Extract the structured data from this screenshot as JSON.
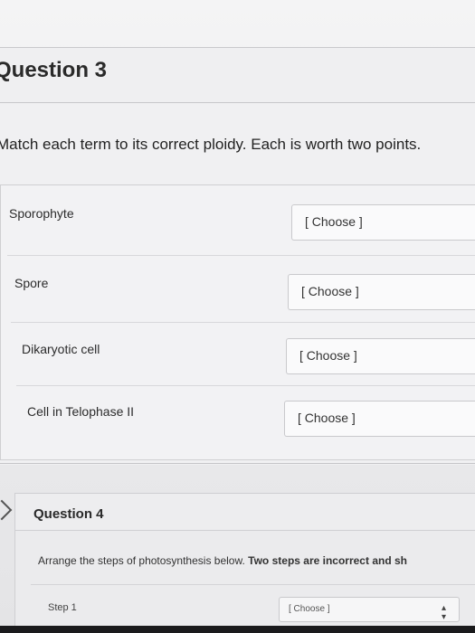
{
  "question3": {
    "title": "Question 3",
    "prompt": "Match each term to its correct ploidy. Each is worth two points.",
    "rows": [
      {
        "term": "Sporophyte",
        "select_value": "[ Choose ]"
      },
      {
        "term": "Spore",
        "select_value": "[ Choose ]"
      },
      {
        "term": "Dikaryotic cell",
        "select_value": "[ Choose ]"
      },
      {
        "term": "Cell in Telophase II",
        "select_value": "[ Choose ]"
      }
    ]
  },
  "question4": {
    "title": "Question 4",
    "prompt_plain": "Arrange the steps of photosynthesis below. ",
    "prompt_bold": "Two steps are incorrect and sh",
    "step_label": "Step 1",
    "step_select_value": "[ Choose ]",
    "select_arrow_icon": "updown-arrow-icon"
  }
}
